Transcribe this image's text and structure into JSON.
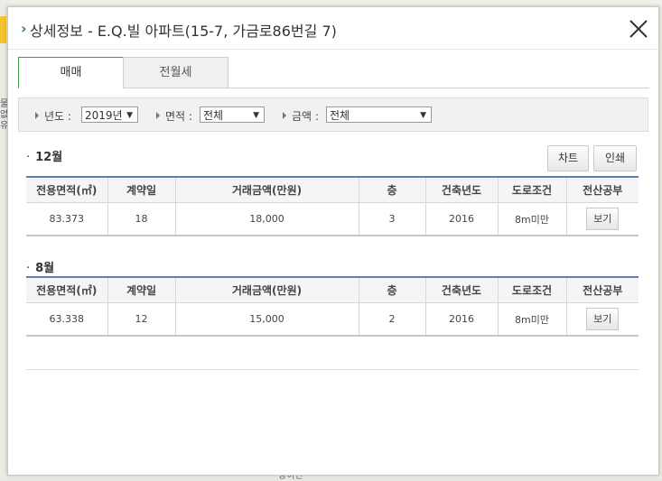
{
  "dialog": {
    "title": "상세정보 - E.Q.빌 아파트(15-7, 가금로86번길 7)"
  },
  "tabs": [
    {
      "label": "매매",
      "active": true
    },
    {
      "label": "전월세",
      "active": false
    }
  ],
  "filters": {
    "year_label": "년도 :",
    "year_value": "2019년",
    "area_label": "면적 :",
    "area_value": "전체",
    "price_label": "금액 :",
    "price_value": "전체"
  },
  "buttons": {
    "chart": "차트",
    "print": "인쇄"
  },
  "columns": [
    "전용면적(㎡)",
    "계약일",
    "거래금액(만원)",
    "층",
    "건축년도",
    "도로조건",
    "전산공부"
  ],
  "sections": [
    {
      "month": "12월",
      "rows": [
        {
          "area": "83.373",
          "day": "18",
          "price": "18,000",
          "floor": "3",
          "year": "2016",
          "road": "8m미만",
          "action": "보기"
        }
      ]
    },
    {
      "month": "8월",
      "rows": [
        {
          "area": "63.338",
          "day": "12",
          "price": "15,000",
          "floor": "2",
          "year": "2016",
          "road": "8m미만",
          "action": "보기"
        }
      ]
    }
  ],
  "map": {
    "side_text": "물 없 유",
    "bottom_text": "광이면"
  },
  "colors": {
    "accent_green": "#2e8b3a",
    "table_header_border": "#5b7fb1"
  }
}
